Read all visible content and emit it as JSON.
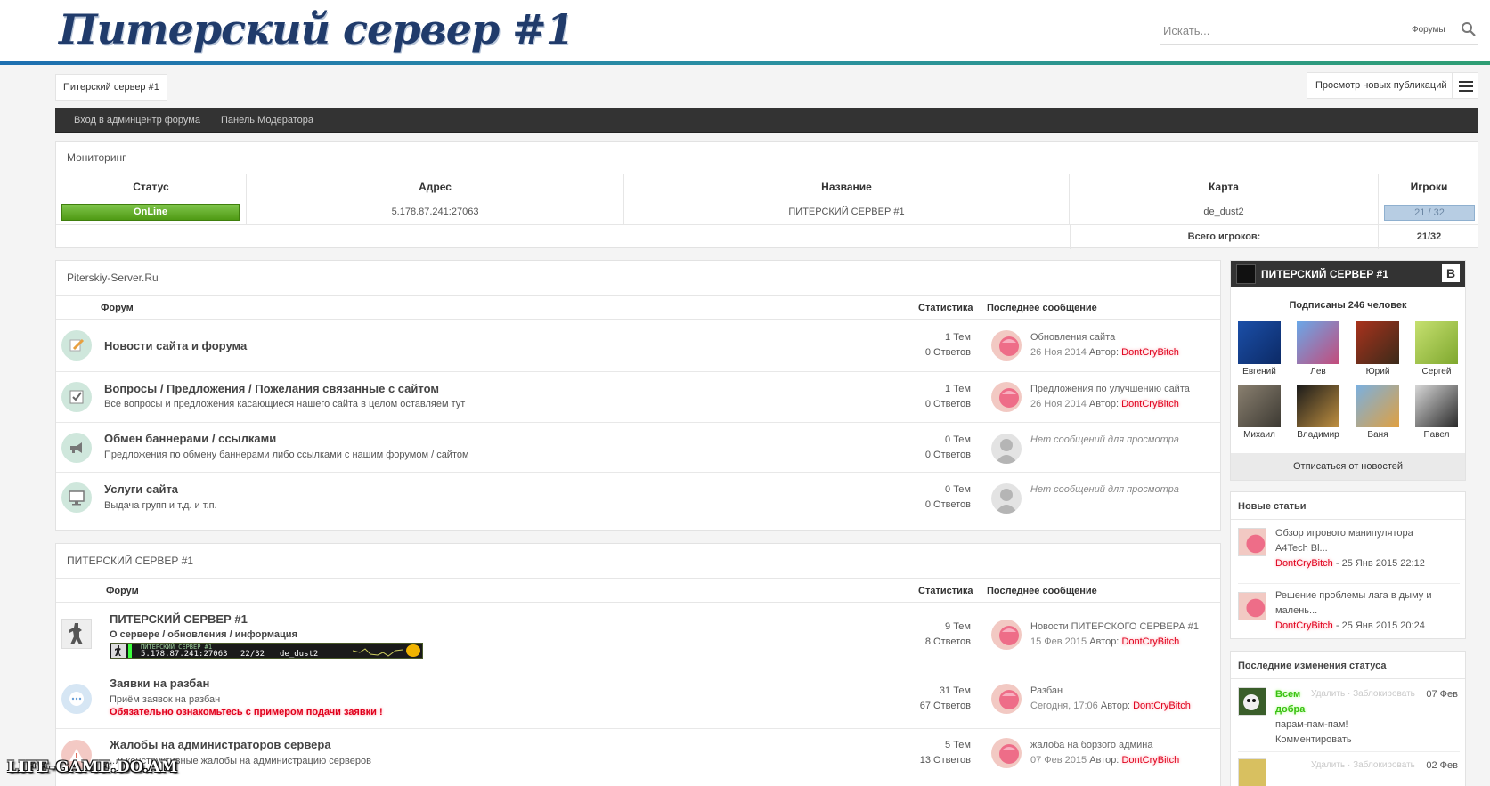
{
  "header": {
    "logo": "Питерский сервер #1",
    "search_placeholder": "Искать...",
    "search_scope": "Форумы"
  },
  "breadcrumb": "Питерский сервер #1",
  "toolbar": {
    "new_posts": "Просмотр новых публикаций"
  },
  "nav": [
    "Вход в админцентр форума",
    "Панель Модератора"
  ],
  "monitoring": {
    "title": "Мониторинг",
    "columns": [
      "Статус",
      "Адрес",
      "Название",
      "Карта",
      "Игроки"
    ],
    "row": {
      "status": "OnLine",
      "address": "5.178.87.241:27063",
      "name": "ПИТЕРСКИЙ СЕРВЕР #1",
      "map": "de_dust2",
      "players": "21 / 32"
    },
    "total_label": "Всего игроков:",
    "total_value": "21/32",
    "players_ratio": 0.656
  },
  "forum1": {
    "title": "Piterskiy-Server.Ru",
    "col_forum": "Форум",
    "col_stats": "Статистика",
    "col_last": "Последнее сообщение",
    "rows": [
      {
        "title": "Новости сайта и форума",
        "desc": "",
        "topics": "1 Тем",
        "replies": "0 Ответов",
        "last_title": "Обновления сайта",
        "last_date": "26 Ноя 2014",
        "author_label": "Автор:",
        "author": "DontCryBitch",
        "icon": "pencil-icon"
      },
      {
        "title": "Вопросы / Предложения / Пожелания связанные с сайтом",
        "desc": "Все вопросы и предложения касающиеся нашего сайта в целом оставляем тут",
        "topics": "1 Тем",
        "replies": "0 Ответов",
        "last_title": "Предложения по улучшению сайта",
        "last_date": "26 Ноя 2014",
        "author_label": "Автор:",
        "author": "DontCryBitch",
        "icon": "checkbox-icon"
      },
      {
        "title": "Обмен баннерами / ссылками",
        "desc": "Предложения по обмену баннерами либо ссылками с нашим форумом / сайтом",
        "topics": "0 Тем",
        "replies": "0 Ответов",
        "no_msg": "Нет сообщений для просмотра",
        "icon": "megaphone-icon"
      },
      {
        "title": "Услуги сайта",
        "desc": "Выдача групп и т.д. и т.п.",
        "topics": "0 Тем",
        "replies": "0 Ответов",
        "no_msg": "Нет сообщений для просмотра",
        "icon": "monitor-icon"
      }
    ]
  },
  "forum2": {
    "title": "ПИТЕРСКИЙ СЕРВЕР #1",
    "col_forum": "Форум",
    "col_stats": "Статистика",
    "col_last": "Последнее сообщение",
    "rows": [
      {
        "title": "ПИТЕРСКИЙ СЕРВЕР #1",
        "desc": "О сервере / обновления / информация",
        "banner_title": "ПИТЕРСКИЙ СЕРВЕР #1",
        "banner_ip": "5.178.87.241:27063",
        "banner_players": "22/32",
        "banner_map": "de_dust2",
        "topics": "9 Тем",
        "replies": "8 Ответов",
        "last_title": "Новости ПИТЕРСКОГО СЕРВЕРА #1",
        "last_date": "15 Фев 2015",
        "author_label": "Автор:",
        "author": "DontCryBitch"
      },
      {
        "title": "Заявки на разбан",
        "desc": "Приём заявок на разбан",
        "warning": "Обязательно ознакомьтесь с примером подачи заявки !",
        "topics": "31 Тем",
        "replies": "67 Ответов",
        "last_title": "Разбан",
        "last_date": "Сегодня, 17:06",
        "author_label": "Автор:",
        "author": "DontCryBitch"
      },
      {
        "title": "Жалобы на администраторов сервера",
        "desc": "...и конструктивные жалобы на администрацию серверов",
        "topics": "5 Тем",
        "replies": "13 Ответов",
        "last_title": "жалоба на борзого админа",
        "last_date": "07 Фев 2015",
        "author_label": "Автор:",
        "author": "DontCryBitch"
      }
    ]
  },
  "vk": {
    "group_name": "ПИТЕРСКИЙ СЕРВЕР #1",
    "logo": "В",
    "subscribers": "Подписаны 246 человек",
    "members": [
      "Евгений",
      "Лев",
      "Юрий",
      "Сергей",
      "Михаил",
      "Владимир",
      "Ваня",
      "Павел"
    ],
    "unsubscribe": "Отписаться от новостей"
  },
  "articles": {
    "title": "Новые статьи",
    "items": [
      {
        "title": "Обзор игрового манипулятора A4Tech Bl...",
        "author": "DontCryBitch",
        "date": " - 25 Янв 2015 22:12"
      },
      {
        "title": "Решение проблемы лага в дыму и малень...",
        "author": "DontCryBitch",
        "date": " - 25 Янв 2015 20:24"
      }
    ]
  },
  "status_updates": {
    "title": "Последние изменения статуса",
    "item": {
      "name_line1": "Всем",
      "name_line2": "добра",
      "actions": "Удалить · Заблокировать",
      "date": "07 Фев",
      "text": "парам-пам-пам!",
      "comment": "Комментировать"
    },
    "next_date": "02 Фев",
    "next_actions": "Удалить · Заблокировать"
  },
  "watermark": "LIFE-GAME.DO.AM"
}
